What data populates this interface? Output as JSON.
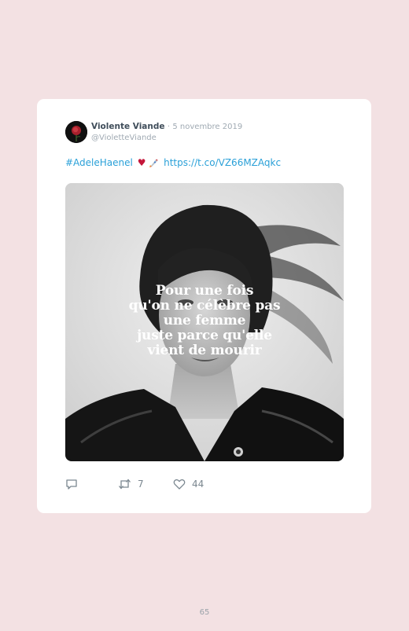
{
  "tweet": {
    "author_name": "Violente Viande",
    "separator": "·",
    "date": "5 novembre 2019",
    "handle": "@VioletteViande",
    "hashtag": "#AdeleHaenel",
    "emoji_heart": "♥",
    "link": "https://t.co/VZ66MZAqkc",
    "image": {
      "description_icon": "portrait-photo",
      "overlay_lines": [
        "Pour une fois",
        "qu'on ne célèbre pas",
        "une femme",
        "juste parce qu'elle",
        "vient de mourir"
      ]
    },
    "actions": {
      "reply_icon": "reply-icon",
      "retweet_icon": "retweet-icon",
      "retweet_count": "7",
      "like_icon": "heart-icon",
      "like_count": "44"
    }
  },
  "colors": {
    "background": "#f3e1e3",
    "card": "#ffffff",
    "link": "#2aa0d8",
    "heart": "#c4163a",
    "muted": "#a0aab3"
  },
  "page": {
    "number": "65"
  }
}
